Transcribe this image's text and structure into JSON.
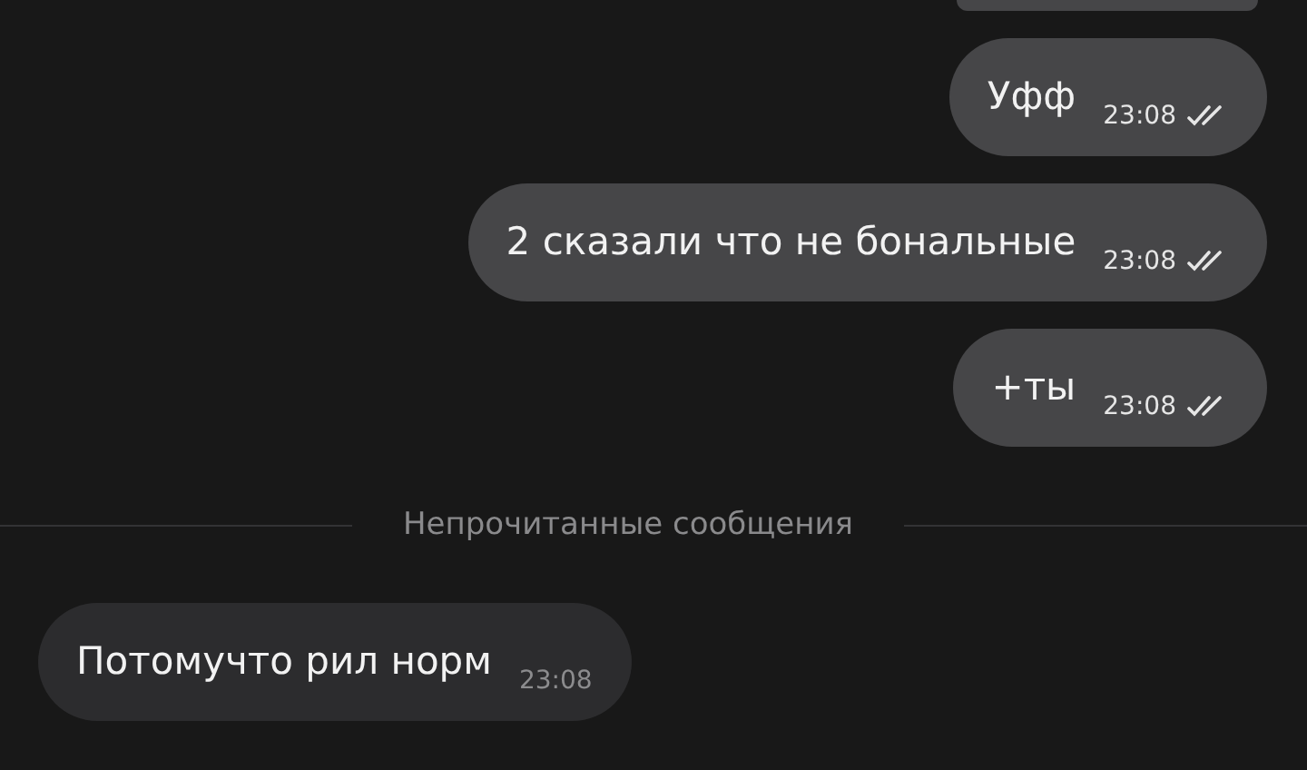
{
  "messages": [
    {
      "kind": "outgoing",
      "text": "Уфф",
      "time": "23:08",
      "read": true
    },
    {
      "kind": "outgoing",
      "text": "2 сказали что не бональные",
      "time": "23:08",
      "read": true
    },
    {
      "kind": "outgoing",
      "text": "+ты",
      "time": "23:08",
      "read": true
    },
    {
      "kind": "divider",
      "text": "Непрочитанные сообщения"
    },
    {
      "kind": "incoming",
      "text": "Потомучто рил норм",
      "time": "23:08",
      "read": false
    }
  ]
}
